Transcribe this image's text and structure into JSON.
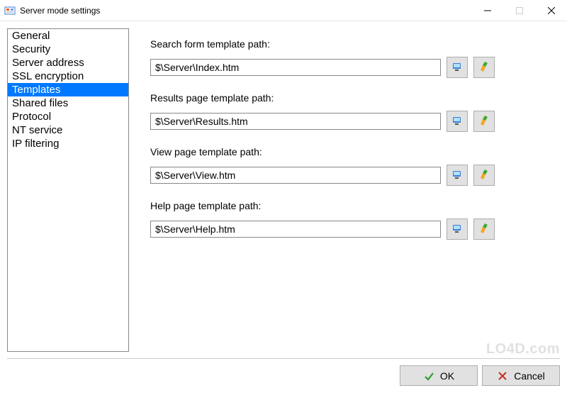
{
  "window": {
    "title": "Server mode settings"
  },
  "sidebar": {
    "items": [
      {
        "label": "General",
        "selected": false
      },
      {
        "label": "Security",
        "selected": false
      },
      {
        "label": "Server address",
        "selected": false
      },
      {
        "label": "SSL encryption",
        "selected": false
      },
      {
        "label": "Templates",
        "selected": true
      },
      {
        "label": "Shared files",
        "selected": false
      },
      {
        "label": "Protocol",
        "selected": false
      },
      {
        "label": "NT service",
        "selected": false
      },
      {
        "label": "IP filtering",
        "selected": false
      }
    ]
  },
  "fields": [
    {
      "label": "Search form template path:",
      "value": "$\\Server\\Index.htm"
    },
    {
      "label": "Results page template path:",
      "value": "$\\Server\\Results.htm"
    },
    {
      "label": "View page template path:",
      "value": "$\\Server\\View.htm"
    },
    {
      "label": "Help page template path:",
      "value": "$\\Server\\Help.htm"
    }
  ],
  "buttons": {
    "ok": "OK",
    "cancel": "Cancel"
  },
  "icons": {
    "browse": "browse-computer-icon",
    "reset": "reset-brush-icon"
  },
  "watermark": "LO4D.com"
}
